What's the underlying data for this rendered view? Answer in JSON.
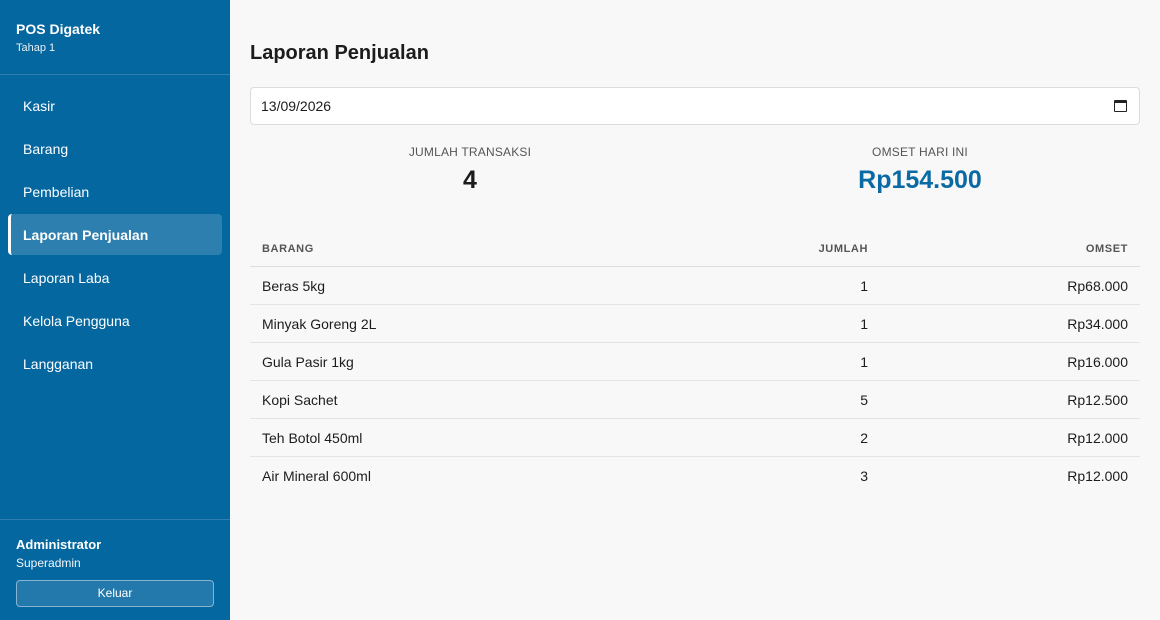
{
  "brand": {
    "name": "POS Digatek",
    "subtitle": "Tahap 1"
  },
  "nav": {
    "items": [
      {
        "label": "Kasir"
      },
      {
        "label": "Barang"
      },
      {
        "label": "Pembelian"
      },
      {
        "label": "Laporan Penjualan",
        "active": true
      },
      {
        "label": "Laporan Laba"
      },
      {
        "label": "Kelola Pengguna"
      },
      {
        "label": "Langganan"
      }
    ]
  },
  "user": {
    "name": "Administrator",
    "role": "Superadmin",
    "logout_label": "Keluar"
  },
  "page": {
    "title": "Laporan Penjualan"
  },
  "filter": {
    "date_value": "13/09/2026",
    "icon": "calendar-icon"
  },
  "stats": {
    "transactions": {
      "label": "JUMLAH TRANSAKSI",
      "value": "4"
    },
    "turnover": {
      "label": "OMSET HARI INI",
      "value": "Rp154.500",
      "color": "#0a6aa4"
    }
  },
  "table": {
    "headers": {
      "item": "BARANG",
      "qty": "JUMLAH",
      "turnover": "OMSET"
    },
    "rows": [
      {
        "item": "Beras 5kg",
        "qty": "1",
        "turnover": "Rp68.000"
      },
      {
        "item": "Minyak Goreng 2L",
        "qty": "1",
        "turnover": "Rp34.000"
      },
      {
        "item": "Gula Pasir 1kg",
        "qty": "1",
        "turnover": "Rp16.000"
      },
      {
        "item": "Kopi Sachet",
        "qty": "5",
        "turnover": "Rp12.500"
      },
      {
        "item": "Teh Botol 450ml",
        "qty": "2",
        "turnover": "Rp12.000"
      },
      {
        "item": "Air Mineral 600ml",
        "qty": "3",
        "turnover": "Rp12.000"
      }
    ]
  },
  "colors": {
    "sidebar": "#0567a0",
    "accent": "#0a6aa4",
    "background": "#f8f8f8"
  }
}
